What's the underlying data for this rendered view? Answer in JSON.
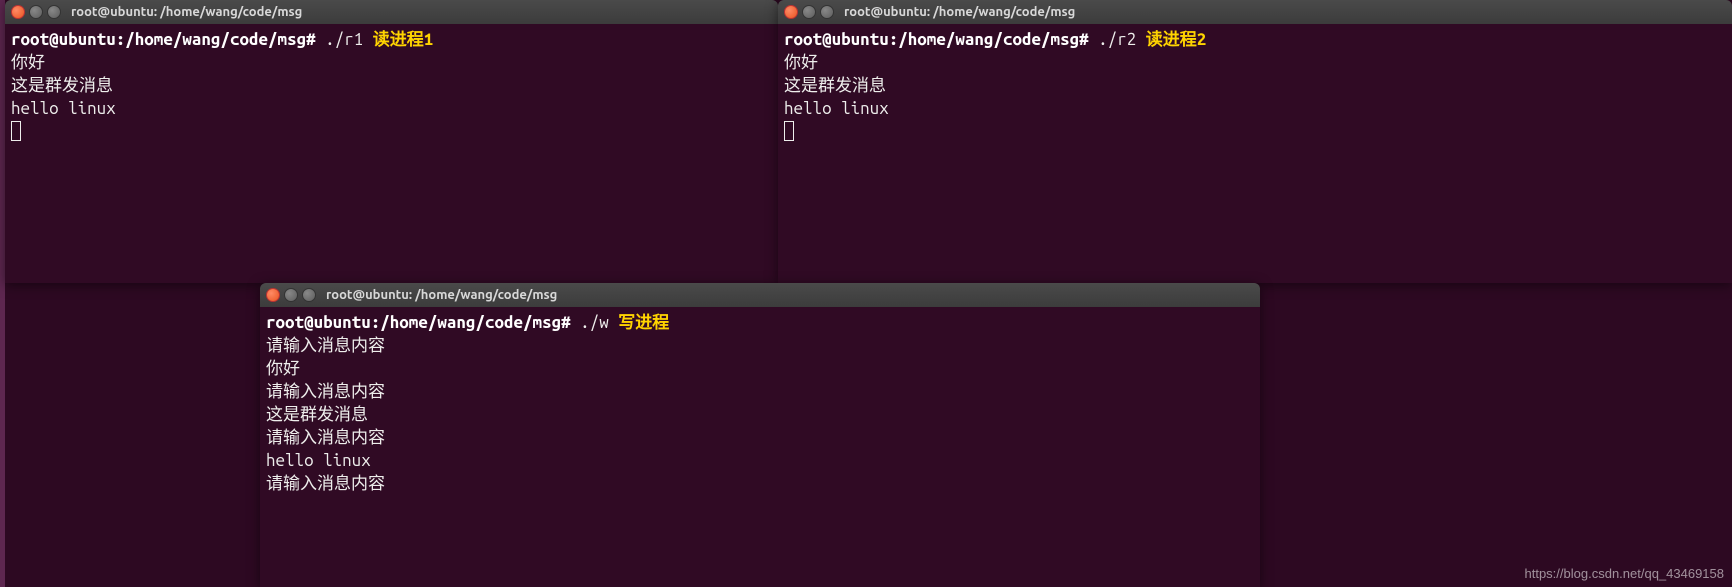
{
  "watermark": "https://blog.csdn.net/qq_43469158",
  "terminals": {
    "t1": {
      "title": "root@ubuntu: /home/wang/code/msg",
      "prompt": "root@ubuntu:/home/wang/code/msg# ",
      "command": "./r1",
      "annotation": " 读进程1",
      "output": [
        "你好",
        "这是群发消息",
        "hello linux"
      ]
    },
    "t2": {
      "title": "root@ubuntu: /home/wang/code/msg",
      "prompt": "root@ubuntu:/home/wang/code/msg# ",
      "command": "./r2",
      "annotation": " 读进程2",
      "output": [
        "你好",
        "这是群发消息",
        "hello linux"
      ]
    },
    "t3": {
      "title": "root@ubuntu: /home/wang/code/msg",
      "prompt": "root@ubuntu:/home/wang/code/msg# ",
      "command": "./w",
      "annotation": " 写进程",
      "output": [
        "请输入消息内容",
        "你好",
        "请输入消息内容",
        "这是群发消息",
        "请输入消息内容",
        "hello linux",
        "请输入消息内容"
      ]
    }
  }
}
